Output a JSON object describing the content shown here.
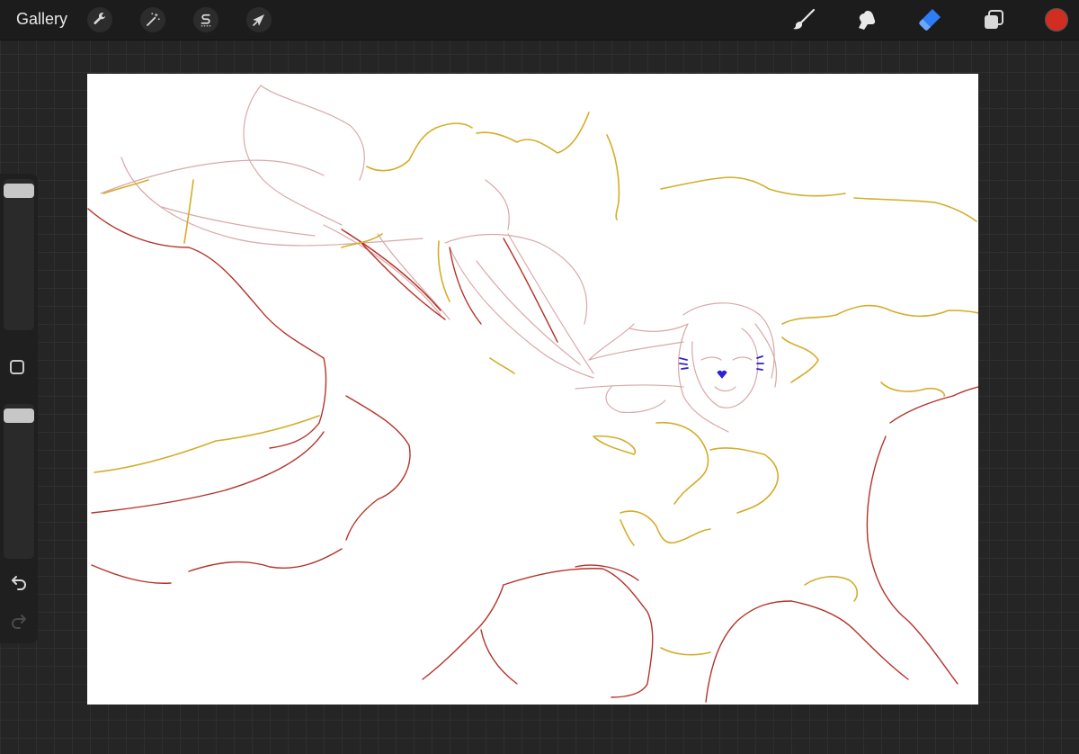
{
  "topbar": {
    "gallery_label": "Gallery",
    "left_tools": [
      {
        "name": "actions",
        "icon": "wrench-icon"
      },
      {
        "name": "adjustments",
        "icon": "magic-wand-icon"
      },
      {
        "name": "selection",
        "icon": "selection-s-icon"
      },
      {
        "name": "transform",
        "icon": "arrow-cursor-icon"
      }
    ],
    "right_tools": [
      {
        "name": "brush",
        "icon": "brush-icon",
        "active": false
      },
      {
        "name": "smudge",
        "icon": "smudge-finger-icon",
        "active": false
      },
      {
        "name": "eraser",
        "icon": "eraser-icon",
        "active": true
      },
      {
        "name": "layers",
        "icon": "layers-icon",
        "active": false
      }
    ],
    "current_color": "#d12d20",
    "accent_color": "#2d7df6"
  },
  "sidebar": {
    "brush_size_level": 0.1,
    "opacity_level": 0.1,
    "modify_icon": "square-modify-icon",
    "undo_icon": "undo-icon",
    "redo_icon": "redo-icon"
  },
  "canvas": {
    "background": "#ffffff",
    "sketch_colors": {
      "red": "#b5322a",
      "pink": "#d9a8a8",
      "yellow": "#d4ad2a",
      "blue": "#2a22d6"
    }
  }
}
